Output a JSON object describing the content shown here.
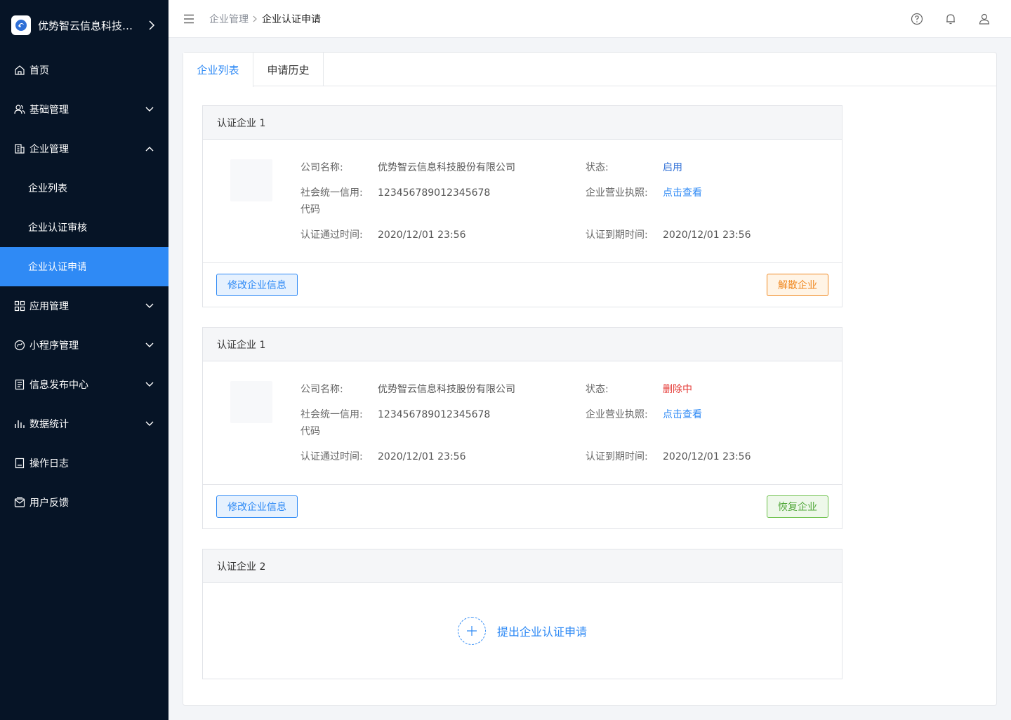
{
  "brand": {
    "name": "优势智云信息科技股份有限公司",
    "logo_icon": "cloud-logo-icon"
  },
  "sidebar": {
    "items": [
      {
        "label": "首页",
        "icon": "home-icon"
      },
      {
        "label": "基础管理",
        "icon": "users-icon",
        "expanded": false
      },
      {
        "label": "企业管理",
        "icon": "building-icon",
        "expanded": true
      },
      {
        "label": "应用管理",
        "icon": "grid-icon",
        "expanded": false
      },
      {
        "label": "小程序管理",
        "icon": "miniprogram-icon",
        "expanded": false
      },
      {
        "label": "信息发布中心",
        "icon": "document-icon",
        "expanded": false
      },
      {
        "label": "数据统计",
        "icon": "bar-chart-icon",
        "expanded": false
      },
      {
        "label": "操作日志",
        "icon": "log-icon"
      },
      {
        "label": "用户反馈",
        "icon": "feedback-icon"
      }
    ],
    "sub_items": [
      {
        "label": "企业列表",
        "active": false
      },
      {
        "label": "企业认证审核",
        "active": false
      },
      {
        "label": "企业认证申请",
        "active": true
      }
    ]
  },
  "header": {
    "breadcrumb": [
      "企业管理",
      "企业认证申请"
    ],
    "icons": [
      "help-icon",
      "bell-icon",
      "user-icon"
    ]
  },
  "tabs": [
    {
      "label": "企业列表",
      "active": true
    },
    {
      "label": "申请历史",
      "active": false
    }
  ],
  "labels": {
    "company_name": "公司名称:",
    "credit_code_line1": "社会统一信用:",
    "credit_code_line2": "代码",
    "approved_time": "认证通过时间:",
    "status": "状态:",
    "license": "企业营业执照:",
    "expire_time": "认证到期时间:",
    "view_link": "点击查看",
    "edit_button": "修改企业信息"
  },
  "cards": [
    {
      "title": "认证企业 1",
      "company_name": "优势智云信息科技股份有限公司",
      "credit_code": "123456789012345678",
      "approved_time": "2020/12/01 23:56",
      "status": "启用",
      "status_color": "#2f6fd6",
      "expire_time": "2020/12/01 23:56",
      "action": "解散企业"
    },
    {
      "title": "认证企业 1",
      "company_name": "优势智云信息科技股份有限公司",
      "credit_code": "123456789012345678",
      "approved_time": "2020/12/01 23:56",
      "status": "删除中",
      "status_color": "#e53935",
      "expire_time": "2020/12/01 23:56",
      "action": "恢复企业"
    }
  ],
  "apply_card": {
    "title": "认证企业 2",
    "action": "提出企业认证申请"
  },
  "colors": {
    "accent": "#2f8af5",
    "sidebar_bg": "#061426",
    "warning": "#f08a24",
    "success": "#52a83b",
    "danger": "#e53935"
  }
}
